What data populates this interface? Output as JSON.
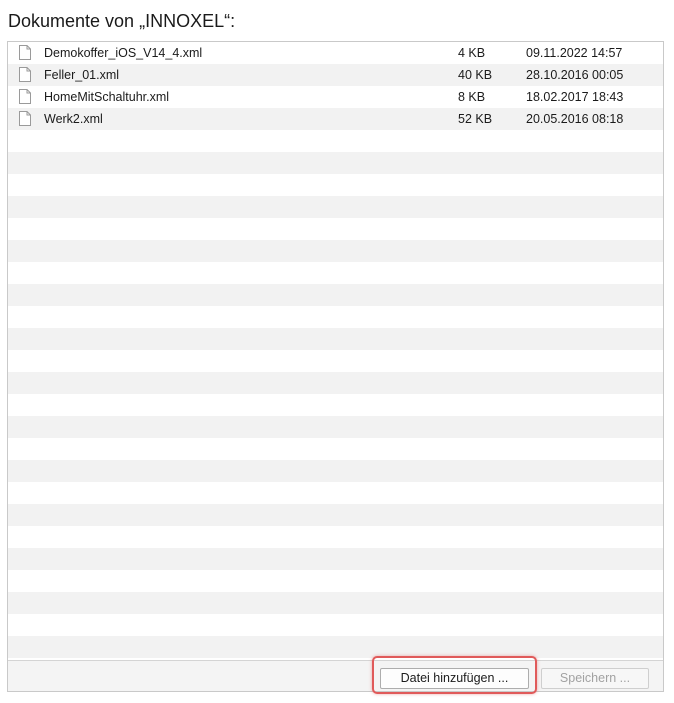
{
  "header": {
    "title": "Dokumente von „INNOXEL“:"
  },
  "files": [
    {
      "name": "Demokoffer_iOS_V14_4.xml",
      "size": "4 KB",
      "date": "09.11.2022 14:57",
      "icon": "document-icon"
    },
    {
      "name": "Feller_01.xml",
      "size": "40 KB",
      "date": "28.10.2016 00:05",
      "icon": "document-icon"
    },
    {
      "name": "HomeMitSchaltuhr.xml",
      "size": "8 KB",
      "date": "18.02.2017 18:43",
      "icon": "document-icon"
    },
    {
      "name": "Werk2.xml",
      "size": "52 KB",
      "date": "20.05.2016 08:18",
      "icon": "document-icon"
    }
  ],
  "footer": {
    "add_label": "Datei hinzufügen ...",
    "save_label": "Speichern ...",
    "save_enabled": false,
    "highlight_color": "#e05a5a"
  }
}
